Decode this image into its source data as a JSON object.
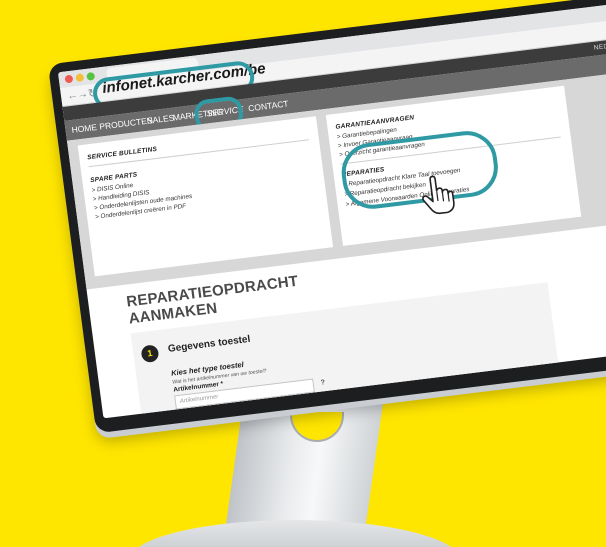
{
  "browser": {
    "url": "infonet.karcher.com/be",
    "icons": {
      "back": "back-arrow-icon",
      "forward": "forward-arrow-icon",
      "reload": "reload-icon",
      "bookmark": "star-icon",
      "menu": "menu-icon"
    }
  },
  "header": {
    "language": "NEDERLANDS"
  },
  "nav": {
    "items": [
      "HOME",
      "PRODUCTEN",
      "SALES",
      "MARKETING",
      "SERVICE",
      "CONTACT"
    ],
    "active": "SERVICE"
  },
  "menu": {
    "left": {
      "bulletins_heading": "SERVICE BULLETINS",
      "spare_heading": "SPARE PARTS",
      "spare_links": [
        "> DISIS Online",
        "> Handleiding DISIS",
        "> Onderdelenlijsten oude machines",
        "> Onderdelenlijst creëren in PDF"
      ]
    },
    "right": {
      "warranty_heading": "GARANTIEAANVRAGEN",
      "warranty_links": [
        "> Garantiebepalingen",
        "> Invoer Garantieaanvraag",
        "> Overzicht garantieaanvragen"
      ],
      "repairs_heading": "REPARATIES",
      "repairs_links": [
        "> Reparatieopdracht Klare Taal toevoegen",
        "> Reparatieopdracht bekijken",
        "> Algemene Voorwaarden Online Reparaties"
      ]
    }
  },
  "form": {
    "title": "REPARATIEOPDRACHT AANMAKEN",
    "step_number": "1",
    "step_title": "Gegevens toestel",
    "heading": "Kies het type toestel",
    "help_text": "Wat is het artikelnummer van uw toestel?",
    "field_label": "Artikelnummer *",
    "field_placeholder": "Artikelnummer",
    "help_symbol": "?"
  },
  "colors": {
    "background": "#FFE600",
    "highlight": "#2f9aa3",
    "nav_bar": "#6b6b6b",
    "header_bar": "#3c3c3c"
  }
}
